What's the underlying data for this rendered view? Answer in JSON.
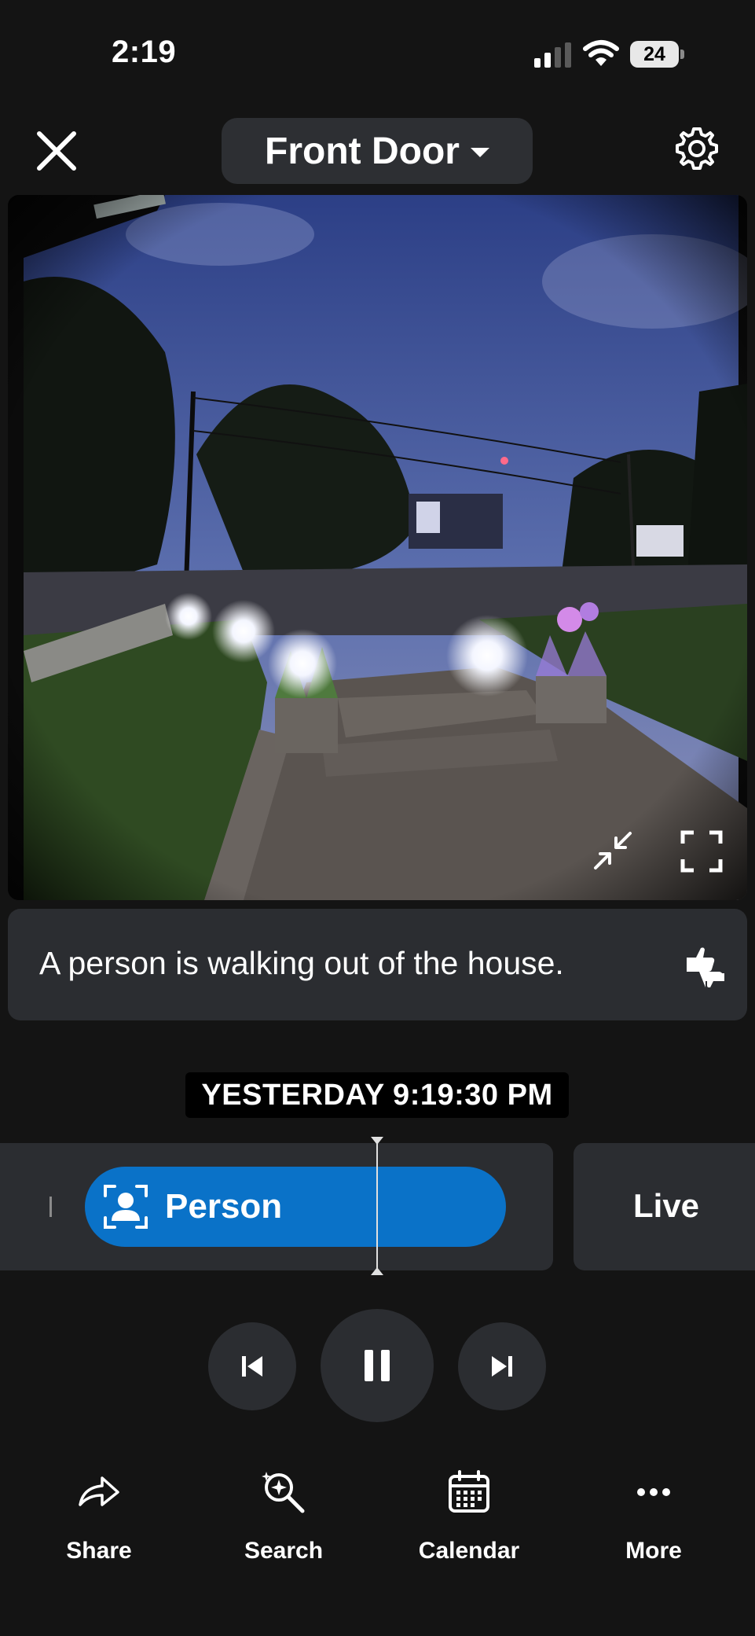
{
  "status_bar": {
    "time": "2:19",
    "battery": "24"
  },
  "header": {
    "camera_name": "Front Door"
  },
  "event": {
    "caption": "A person is walking out of the house."
  },
  "timeline": {
    "timestamp": "YESTERDAY 9:19:30 PM",
    "event_label": "Person",
    "live_label": "Live"
  },
  "bottom_bar": {
    "items": [
      {
        "label": "Share",
        "icon": "share-icon"
      },
      {
        "label": "Search",
        "icon": "search-icon"
      },
      {
        "label": "Calendar",
        "icon": "calendar-icon"
      },
      {
        "label": "More",
        "icon": "more-icon"
      }
    ]
  },
  "colors": {
    "background": "#141414",
    "card": "#2b2d31",
    "event_pill": "#0a72c8"
  }
}
